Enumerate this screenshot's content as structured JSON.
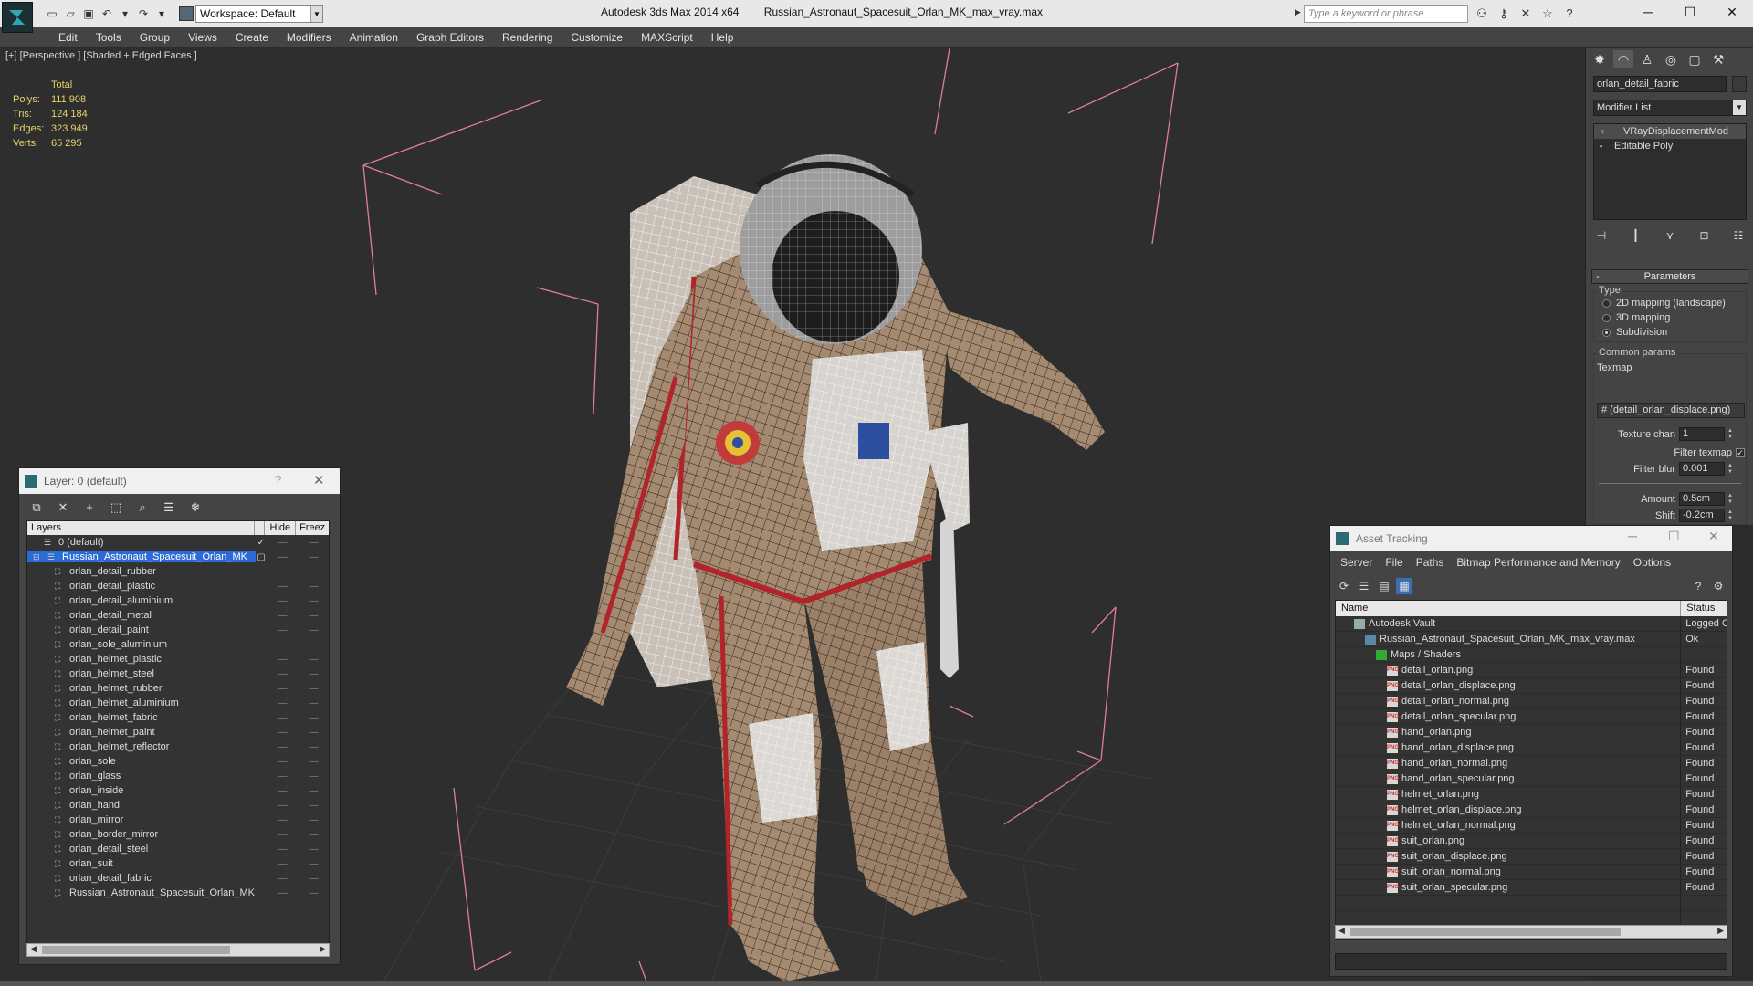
{
  "titlebar": {
    "workspace": "Workspace: Default",
    "app_title": "Autodesk 3ds Max  2014 x64",
    "file_name": "Russian_Astronaut_Spacesuit_Orlan_MK_max_vray.max",
    "search_placeholder": "Type a keyword or phrase"
  },
  "menu": [
    "Edit",
    "Tools",
    "Group",
    "Views",
    "Create",
    "Modifiers",
    "Animation",
    "Graph Editors",
    "Rendering",
    "Customize",
    "MAXScript",
    "Help"
  ],
  "viewport": {
    "label": "[+] [Perspective ] [Shaded + Edged Faces ]",
    "stats_header": "Total",
    "stats": [
      {
        "label": "Polys:",
        "value": "111 908"
      },
      {
        "label": "Tris:",
        "value": "124 184"
      },
      {
        "label": "Edges:",
        "value": "323 949"
      },
      {
        "label": "Verts:",
        "value": "65 295"
      }
    ]
  },
  "command_panel": {
    "object_name": "orlan_detail_fabric",
    "modifier_list": "Modifier List",
    "stack": [
      "VRayDisplacementMod",
      "Editable Poly"
    ],
    "parameters_title": "Parameters",
    "type_title": "Type",
    "type_options": [
      "2D mapping (landscape)",
      "3D mapping",
      "Subdivision"
    ],
    "type_selected": 2,
    "common_params_title": "Common params",
    "texmap_label": "Texmap",
    "texmap_value": "# (detail_orlan_displace.png)",
    "texture_chan_label": "Texture chan",
    "texture_chan_value": "1",
    "filter_texmap_label": "Filter texmap",
    "filter_blur_label": "Filter blur",
    "filter_blur_value": "0.001",
    "amount_label": "Amount",
    "amount_value": "0.5cm",
    "shift_label": "Shift",
    "shift_value": "-0.2cm"
  },
  "layer_panel": {
    "title": "Layer: 0 (default)",
    "col_layers": "Layers",
    "col_hide": "Hide",
    "col_freeze": "Freez",
    "default_layer": "0 (default)",
    "selected_layer": "Russian_Astronaut_Spacesuit_Orlan_MK",
    "objects": [
      "orlan_detail_rubber",
      "orlan_detail_plastic",
      "orlan_detail_aluminium",
      "orlan_detail_metal",
      "orlan_detail_paint",
      "orlan_sole_aluminium",
      "orlan_helmet_plastic",
      "orlan_helmet_steel",
      "orlan_helmet_rubber",
      "orlan_helmet_aluminium",
      "orlan_helmet_fabric",
      "orlan_helmet_paint",
      "orlan_helmet_reflector",
      "orlan_sole",
      "orlan_glass",
      "orlan_inside",
      "orlan_hand",
      "orlan_mirror",
      "orlan_border_mirror",
      "orlan_detail_steel",
      "orlan_suit",
      "orlan_detail_fabric",
      "Russian_Astronaut_Spacesuit_Orlan_MK"
    ]
  },
  "asset_panel": {
    "title": "Asset Tracking",
    "menu": [
      "Server",
      "File",
      "Paths",
      "Bitmap Performance and Memory",
      "Options"
    ],
    "col_name": "Name",
    "col_status": "Status",
    "vault": {
      "name": "Autodesk Vault",
      "status": "Logged O"
    },
    "max_file": {
      "name": "Russian_Astronaut_Spacesuit_Orlan_MK_max_vray.max",
      "status": "Ok"
    },
    "maps_group": "Maps / Shaders",
    "maps": [
      {
        "name": "detail_orlan.png",
        "status": "Found"
      },
      {
        "name": "detail_orlan_displace.png",
        "status": "Found"
      },
      {
        "name": "detail_orlan_normal.png",
        "status": "Found"
      },
      {
        "name": "detail_orlan_specular.png",
        "status": "Found"
      },
      {
        "name": "hand_orlan.png",
        "status": "Found"
      },
      {
        "name": "hand_orlan_displace.png",
        "status": "Found"
      },
      {
        "name": "hand_orlan_normal.png",
        "status": "Found"
      },
      {
        "name": "hand_orlan_specular.png",
        "status": "Found"
      },
      {
        "name": "helmet_orlan.png",
        "status": "Found"
      },
      {
        "name": "helmet_orlan_displace.png",
        "status": "Found"
      },
      {
        "name": "helmet_orlan_normal.png",
        "status": "Found"
      },
      {
        "name": "suit_orlan.png",
        "status": "Found"
      },
      {
        "name": "suit_orlan_displace.png",
        "status": "Found"
      },
      {
        "name": "suit_orlan_normal.png",
        "status": "Found"
      },
      {
        "name": "suit_orlan_specular.png",
        "status": "Found"
      }
    ]
  },
  "colors": {
    "selection": "#2b6bd8",
    "stats_text": "#e8d36a",
    "bbox_lines": "#e07aa6",
    "suit_fabric": "#a48a71",
    "suit_trim": "#b0242a"
  }
}
